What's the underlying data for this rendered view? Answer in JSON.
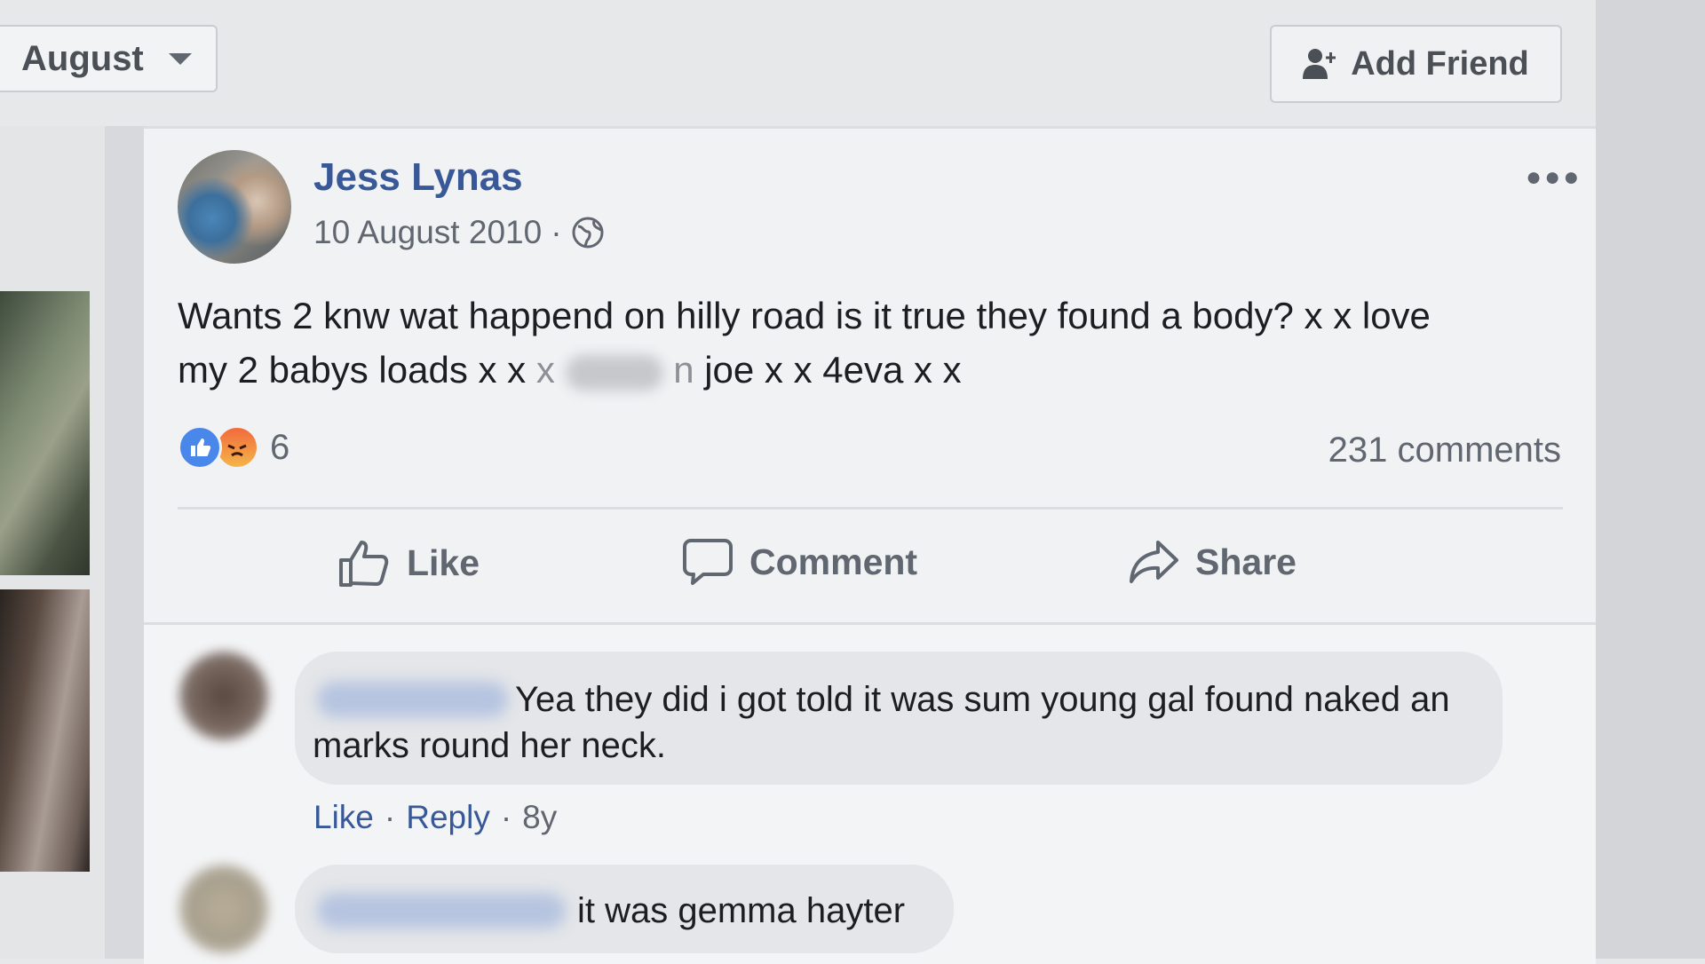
{
  "month_filter": {
    "selected": "August"
  },
  "add_friend": {
    "label": "Add Friend"
  },
  "post": {
    "author": "Jess Lynas",
    "date": "10 August 2010",
    "separator": "·",
    "text_line1": "Wants 2 knw wat happend on hilly road is it true they found a body? x x love",
    "text_line2_prefix": "my 2 babys loads x x",
    "text_line2_faded": "x",
    "text_line2_suffix_faded": "n",
    "text_line2_suffix": "joe x x 4eva x x",
    "reaction_count": "6",
    "comment_count": "231 comments",
    "actions": {
      "like": "Like",
      "comment": "Comment",
      "share": "Share"
    }
  },
  "comments": [
    {
      "text": "Yea they did i got told it was sum young gal found naked an marks round her neck.",
      "like_label": "Like",
      "reply_label": "Reply",
      "time": "8y"
    },
    {
      "text": "it was gemma hayter"
    }
  ],
  "colors": {
    "link_blue": "#385898",
    "like_blue": "#4a87ea",
    "angry_orange": "#f26a3c"
  }
}
